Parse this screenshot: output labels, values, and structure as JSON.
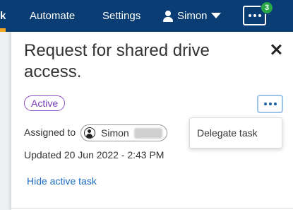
{
  "nav": {
    "fragment": "k",
    "items": [
      "Automate",
      "Settings"
    ],
    "user_name": "Simon",
    "notification_count": "3"
  },
  "panel": {
    "title": "Request for shared drive access.",
    "status": "Active",
    "assigned_label": "Assigned to",
    "assignee": "Simon",
    "updated": "Updated 20 Jun 2022 - 2:43 PM",
    "hide_link": "Hide active task"
  },
  "menu": {
    "items": [
      "Delegate task"
    ]
  },
  "colors": {
    "nav_bg": "#0a3d73",
    "status_purple": "#7a3db8",
    "link_blue": "#1a6bbf",
    "badge_green": "#27a745"
  }
}
